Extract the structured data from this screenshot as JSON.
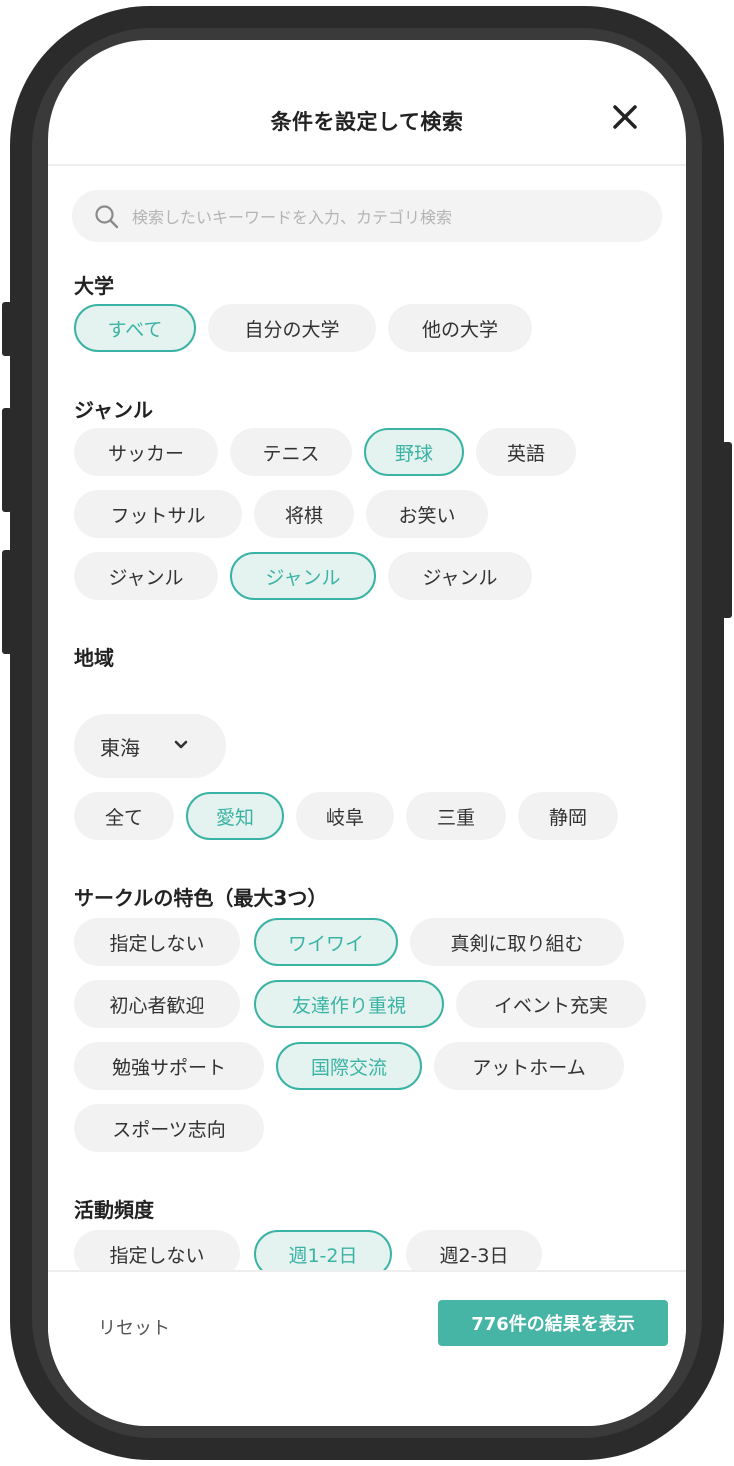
{
  "header": {
    "title": "条件を設定して検索"
  },
  "search": {
    "placeholder": "検索したいキーワードを入力、カテゴリ検索"
  },
  "sections": {
    "university": {
      "label": "大学",
      "chips": [
        "すべて",
        "自分の大学",
        "他の大学"
      ],
      "selected": [
        "すべて"
      ]
    },
    "genre": {
      "label": "ジャンル",
      "chips": [
        "サッカー",
        "テニス",
        "野球",
        "英語",
        "フットサル",
        "将棋",
        "お笑い",
        "ジャンル",
        "ジャンル",
        "ジャンル"
      ],
      "selected_index": [
        2,
        8
      ]
    },
    "region": {
      "label": "地域",
      "dropdown_value": "東海",
      "chips": [
        "全て",
        "愛知",
        "岐阜",
        "三重",
        "静岡"
      ],
      "selected": [
        "愛知"
      ]
    },
    "features": {
      "label": "サークルの特色（最大3つ）",
      "chips": [
        "指定しない",
        "ワイワイ",
        "真剣に取り組む",
        "初心者歓迎",
        "友達作り重視",
        "イベント充実",
        "勉強サポート",
        "国際交流",
        "アットホーム",
        "スポーツ志向"
      ],
      "selected": [
        "ワイワイ",
        "友達作り重視",
        "国際交流"
      ]
    },
    "frequency": {
      "label": "活動頻度",
      "chips": [
        "指定しない",
        "週1-2日",
        "週2-3日"
      ],
      "selected": [
        "週1-2日"
      ]
    }
  },
  "footer": {
    "reset_label": "リセット",
    "show_label": "776件の結果を表示"
  },
  "colors": {
    "accent": "#3ab3a4",
    "accent_bg": "#e4f3f0",
    "chip_bg": "#f2f2f2",
    "button": "#47b5a6"
  },
  "icons": [
    "close-icon",
    "search-icon",
    "chevron-down-icon"
  ]
}
